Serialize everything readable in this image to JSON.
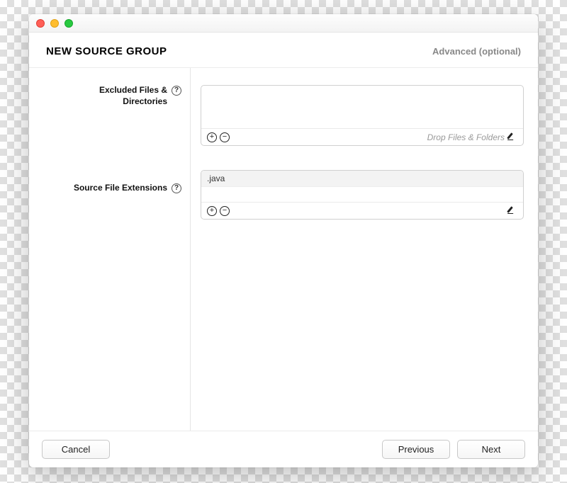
{
  "header": {
    "title": "NEW SOURCE GROUP",
    "advanced": "Advanced (optional)"
  },
  "sections": {
    "excluded": {
      "label": "Excluded Files &\nDirectories",
      "drop_hint": "Drop Files & Folders"
    },
    "extensions": {
      "label": "Source File Extensions",
      "items": [
        ".java"
      ]
    }
  },
  "footer": {
    "cancel": "Cancel",
    "previous": "Previous",
    "next": "Next"
  }
}
